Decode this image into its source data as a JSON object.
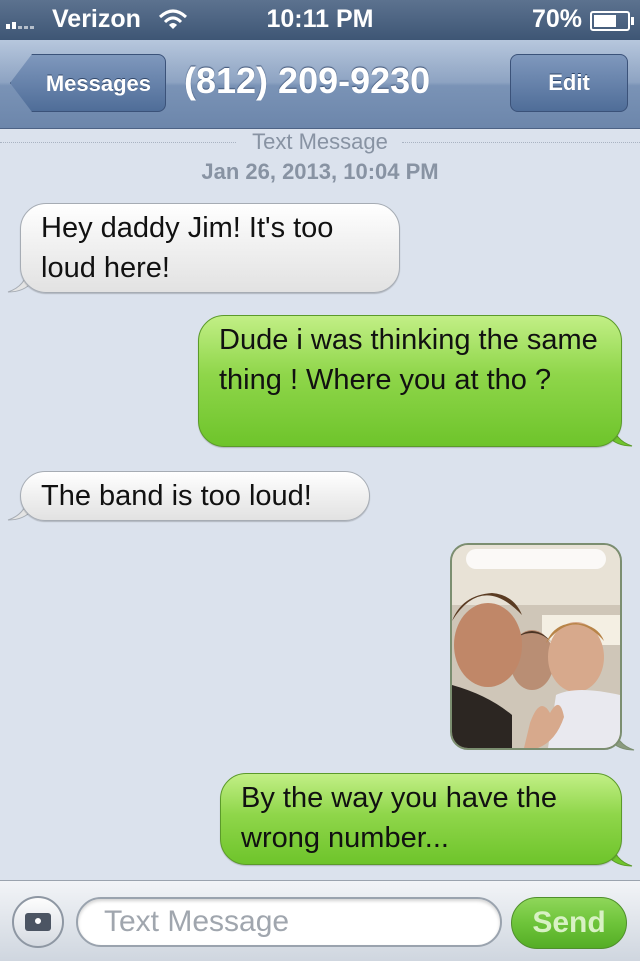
{
  "status_bar": {
    "carrier": "Verizon",
    "time": "10:11 PM",
    "battery": "70%",
    "icons": [
      "signal-icon",
      "wifi-icon",
      "battery-icon"
    ]
  },
  "nav": {
    "back_label": "Messages",
    "title": "(812) 209-9230",
    "edit_label": "Edit"
  },
  "thread": {
    "section_label": "Text Message",
    "timestamp": "Jan 26, 2013, 10:04 PM",
    "messages": [
      {
        "direction": "incoming",
        "text": "Hey daddy Jim! It's too loud here!"
      },
      {
        "direction": "outgoing",
        "text": "Dude i was thinking the same thing ! Where you at tho ?"
      },
      {
        "direction": "incoming",
        "text": "The band is too loud!"
      },
      {
        "direction": "outgoing",
        "type": "photo",
        "text": ""
      },
      {
        "direction": "outgoing",
        "text": "By the way you have the wrong number..."
      }
    ]
  },
  "composer": {
    "placeholder": "Text Message",
    "send_label": "Send",
    "camera_icon": "camera-icon"
  },
  "colors": {
    "incoming_bubble": "#f1f1f1",
    "outgoing_bubble": "#8fd64a",
    "background": "#dbe2ed",
    "nav_bar": "#7a93b6"
  }
}
